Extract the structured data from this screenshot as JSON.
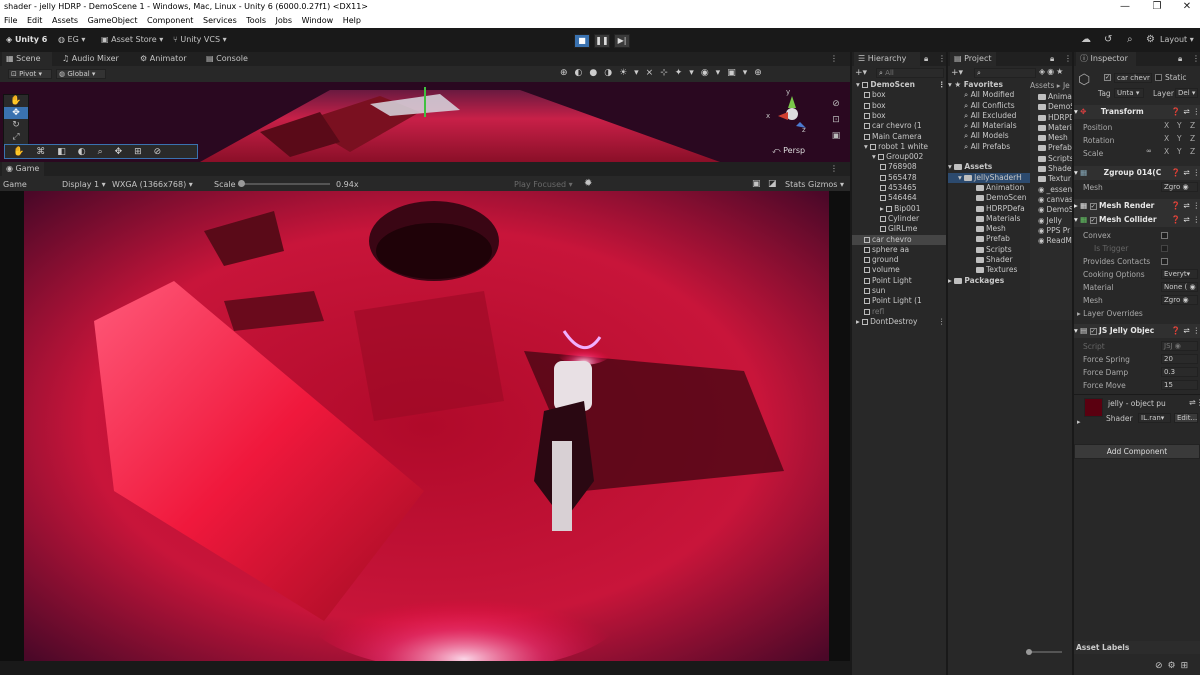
{
  "window": {
    "title": "shader - jelly HDRP - DemoScene 1 - Windows, Mac, Linux - Unity 6 (6000.0.27f1) <DX11>",
    "min": "—",
    "max": "❐",
    "close": "✕"
  },
  "menu": [
    "File",
    "Edit",
    "Assets",
    "GameObject",
    "Component",
    "Services",
    "Tools",
    "Jobs",
    "Window",
    "Help"
  ],
  "toolbar": {
    "unity": "Unity 6",
    "account": "EG",
    "asset_store": "Asset Store",
    "vcs": "Unity VCS",
    "layout": "Layout"
  },
  "left_tabs": {
    "scene": "Scene",
    "audio": "Audio Mixer",
    "animator": "Animator",
    "console": "Console"
  },
  "scene": {
    "pivot": "Pivot",
    "global": "Global",
    "persp": "Persp",
    "axis_x": "x",
    "axis_y": "y",
    "axis_z": "z"
  },
  "game": {
    "tab": "Game",
    "mode": "Game",
    "display": "Display 1",
    "resolution": "WXGA (1366x768)",
    "scale_label": "Scale",
    "scale_value": "0.94x",
    "play_focused": "Play Focused",
    "stats": "Stats",
    "gizmos": "Gizmos"
  },
  "hierarchy": {
    "tab": "Hierarchy",
    "search": "All",
    "rows": [
      {
        "label": "DemoScen",
        "indent": 0,
        "arrow": "▾",
        "bold": true,
        "icon": "unity"
      },
      {
        "label": "box",
        "indent": 1,
        "icon": "cube"
      },
      {
        "label": "box",
        "indent": 1,
        "icon": "cube"
      },
      {
        "label": "box",
        "indent": 1,
        "icon": "cube"
      },
      {
        "label": "car chevro (1",
        "indent": 1,
        "icon": "cube"
      },
      {
        "label": "Main Camera",
        "indent": 1,
        "icon": "cube"
      },
      {
        "label": "robot 1 white",
        "indent": 1,
        "arrow": "▾",
        "icon": "cube"
      },
      {
        "label": "Group002",
        "indent": 2,
        "arrow": "▾",
        "icon": "cube"
      },
      {
        "label": "768908",
        "indent": 3,
        "icon": "cube"
      },
      {
        "label": "565478",
        "indent": 3,
        "icon": "cube"
      },
      {
        "label": "453465",
        "indent": 3,
        "icon": "cube"
      },
      {
        "label": "546464",
        "indent": 3,
        "icon": "cube"
      },
      {
        "label": "Bip001",
        "indent": 3,
        "arrow": "▸",
        "icon": "cube"
      },
      {
        "label": "Cylinder",
        "indent": 3,
        "icon": "cube"
      },
      {
        "label": "GIRLme",
        "indent": 3,
        "icon": "cube"
      },
      {
        "label": "car chevro",
        "indent": 1,
        "icon": "cube",
        "selected": true
      },
      {
        "label": "sphere aa",
        "indent": 1,
        "icon": "cube"
      },
      {
        "label": "ground",
        "indent": 1,
        "icon": "cube"
      },
      {
        "label": "volume",
        "indent": 1,
        "icon": "cube"
      },
      {
        "label": "Point Light",
        "indent": 1,
        "icon": "cube"
      },
      {
        "label": "sun",
        "indent": 1,
        "icon": "cube"
      },
      {
        "label": "Point Light (1",
        "indent": 1,
        "icon": "cube"
      },
      {
        "label": "refl",
        "indent": 1,
        "icon": "cube",
        "dim": true
      },
      {
        "label": "DontDestroy",
        "indent": 0,
        "arrow": "▸",
        "icon": "unity"
      }
    ]
  },
  "project": {
    "tab": "Project",
    "favorites_label": "Favorites",
    "favorites": [
      "All Modified",
      "All Conflicts",
      "All Excluded",
      "All Materials",
      "All Models",
      "All Prefabs"
    ],
    "assets_label": "Assets",
    "assets_root": "JellyShaderH",
    "assets_children": [
      "Animation",
      "DemoScen",
      "HDRPDefa",
      "Materials",
      "Mesh",
      "Prefab",
      "Scripts",
      "Shader",
      "Textures"
    ],
    "packages_label": "Packages",
    "crumb": "Assets",
    "crumb2": "Je",
    "right_items": [
      "Animat",
      "DemoS",
      "HDRPD",
      "Materi",
      "Mesh",
      "Prefab",
      "Scripts",
      "Shader",
      "Textur",
      "_essen",
      "canvas",
      "DemoS",
      "Jelly",
      "PPS Pr",
      "ReadM"
    ]
  },
  "inspector": {
    "tab": "Inspector",
    "object_name": "car chevr",
    "static": "Static",
    "tag_label": "Tag",
    "tag_value": "Unta",
    "layer_label": "Layer",
    "layer_value": "Del",
    "transform": "Transform",
    "position": "Position",
    "rotation": "Rotation",
    "scale": "Scale",
    "x": "X",
    "y": "Y",
    "z": "Z",
    "mesh_filter": "Zgroup 014(C",
    "mesh_label": "Mesh",
    "mesh_value": "Zgro",
    "mesh_renderer": "Mesh Render",
    "mesh_collider": "Mesh Collider",
    "convex": "Convex",
    "is_trigger": "Is Trigger",
    "provides_contacts": "Provides Contacts",
    "cooking_options": "Cooking Options",
    "cooking_value": "Everyt",
    "material_label": "Material",
    "material_value": "None (",
    "mesh2_label": "Mesh",
    "mesh2_value": "Zgro",
    "layer_overrides": "Layer Overrides",
    "script_comp": "JS Jelly Objec",
    "script_label": "Script",
    "script_value": "JSJ",
    "force_spring_label": "Force Spring",
    "force_spring": "20",
    "force_damp_label": "Force Damp",
    "force_damp": "0.3",
    "force_move_label": "Force Move",
    "force_move": "15",
    "mat_name": "jelly - object pu",
    "shader_label": "Shader",
    "shader_value": "IL.ran",
    "edit": "Edit...",
    "add_component": "Add Component",
    "asset_labels": "Asset Labels"
  },
  "colors": {
    "bg": "#191919",
    "panel": "#282828",
    "accent": "#3a72b0",
    "render_red": "#e0103a"
  }
}
